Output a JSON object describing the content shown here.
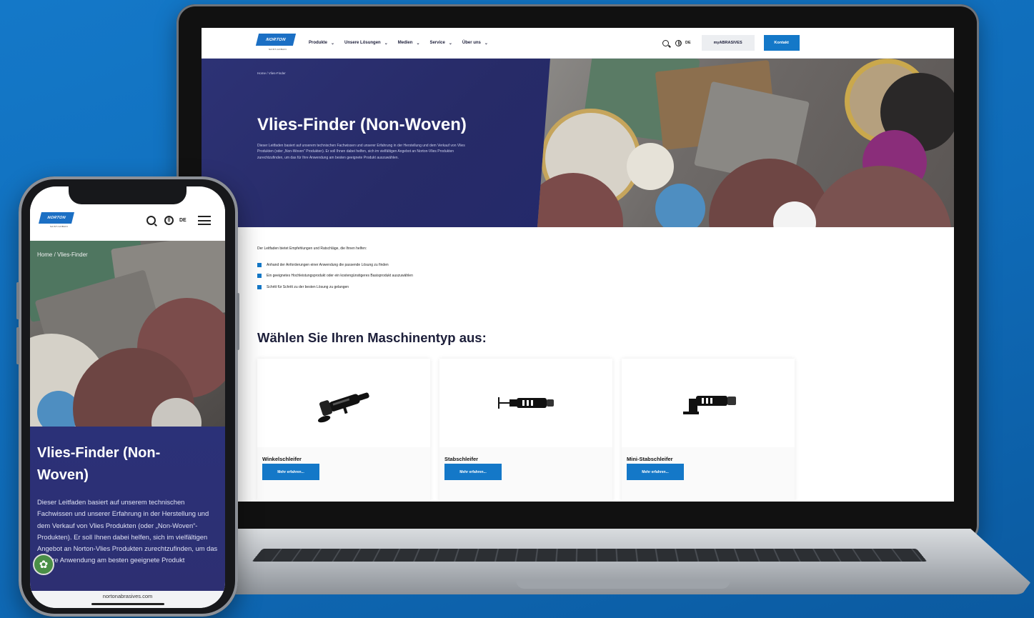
{
  "site": {
    "logo_text": "NORTON",
    "logo_sub": "SAINT-GOBAIN",
    "nav_items": [
      "Produkte",
      "Unsere Lösungen",
      "Medien",
      "Service",
      "Über uns"
    ],
    "lang": "DE",
    "my_abrasives": "myABRASIVES",
    "kontakt": "Kontakt"
  },
  "hero": {
    "breadcrumb": "Home  /  Vlies-Finder",
    "title": "Vlies-Finder (Non-Woven)",
    "description": "Dieser Leitfaden basiert auf unserem technischen Fachwissen und unserer Erfahrung in der Herstellung und dem Verkauf von Vlies Produkten (oder „Non-Woven“ Produkten). Er soll Ihnen dabei helfen, sich im vielfältigen Angebot an Norton-Vlies Produkten zurechtzufinden, um das für Ihre Anwendung am besten geeignete Produkt auszuwählen."
  },
  "content": {
    "intro": "Der Leitfaden bietet Empfehlungen und Ratschläge, die Ihnen helfen:",
    "bullets": [
      "Anhand der Anforderungen einer Anwendung die passende Lösung zu finden",
      "Ein geeignetes Hochleistungsprodukt oder ein kostengünstigeres Basisprodukt auszuwählen",
      "Schritt für Schritt zu der besten Lösung zu gelangen"
    ],
    "section_title": "Wählen Sie Ihren Maschinentyp aus:",
    "cards": [
      {
        "title": "Winkelschleifer",
        "button": "Mehr erfahren..."
      },
      {
        "title": "Stabschleifer",
        "button": "Mehr erfahren..."
      },
      {
        "title": "Mini-Stabschleifer",
        "button": "Mehr erfahren..."
      }
    ]
  },
  "phone": {
    "breadcrumb": "Home  /  Vlies-Finder",
    "title": "Vlies-Finder (Non-Woven)",
    "description": "Dieser Leitfaden basiert auf unserem technischen Fachwissen und unserer Erfahrung in der Herstellung und dem Verkauf von Vlies Produkten (oder „Non-Woven“-Produkten). Er soll Ihnen dabei helfen, sich im vielfältigen Angebot an Norton-Vlies Produkten zurechtzufinden, um das für Ihre Anwendung am besten geeignete Produkt",
    "url": "nortonabrasives.com",
    "lang": "DE"
  },
  "colors": {
    "background": "#1478c8",
    "brand_blue": "#1478c8",
    "hero_navy": "#2b2d6b"
  },
  "icons": [
    "search-icon",
    "globe-icon",
    "chevron-down-icon",
    "menu-icon",
    "cookie-icon"
  ]
}
